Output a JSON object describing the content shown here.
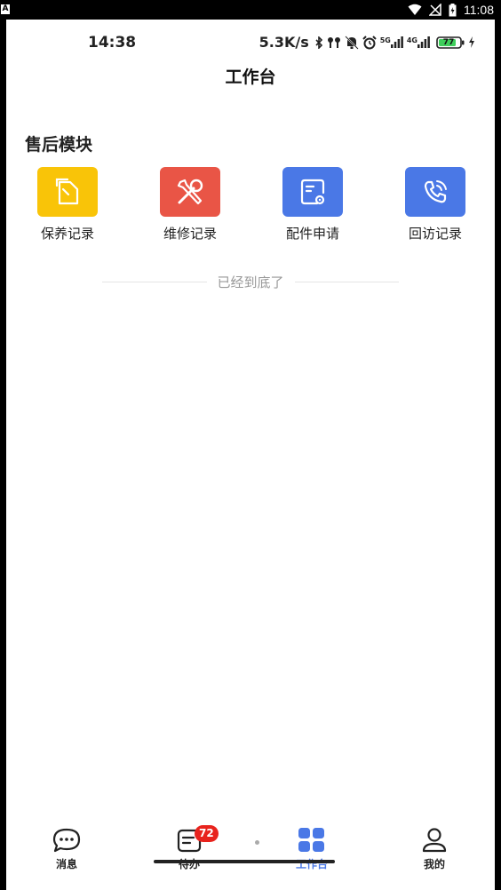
{
  "os_status": {
    "left_badge": "A",
    "time": "11:08"
  },
  "inner_status": {
    "time": "14:38",
    "speed": "5.3K/s",
    "network_5g": "5G",
    "network_4g": "4G",
    "battery": "77"
  },
  "header": {
    "title": "工作台"
  },
  "section": {
    "title": "售后模块"
  },
  "modules": [
    {
      "label": "保养记录",
      "color": "#f9c408",
      "icon": "document-icon"
    },
    {
      "label": "维修记录",
      "color": "#e95546",
      "icon": "tools-icon"
    },
    {
      "label": "配件申请",
      "color": "#4a78e6",
      "icon": "form-gear-icon"
    },
    {
      "label": "回访记录",
      "color": "#4a78e6",
      "icon": "phone-icon"
    }
  ],
  "end_text": "已经到底了",
  "tabbar": {
    "tabs": [
      {
        "label": "消息",
        "icon": "chat-icon"
      },
      {
        "label": "待办",
        "icon": "todo-icon",
        "badge": "72"
      },
      {
        "label": "工作台",
        "icon": "grid-icon",
        "active": true
      },
      {
        "label": "我的",
        "icon": "user-icon"
      }
    ],
    "accent": "#4a78e6",
    "badge_color": "#e8231d"
  }
}
